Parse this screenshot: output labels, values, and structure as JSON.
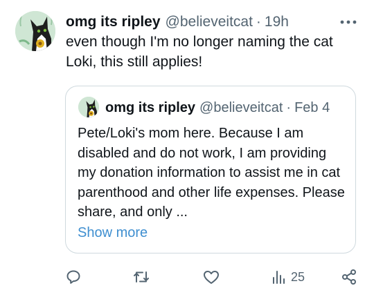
{
  "tweet": {
    "author_name": "omg its ripley",
    "author_handle": "@believeitcat",
    "separator": "·",
    "time": "19h",
    "text": "even though I'm no longer naming the cat Loki, this still applies!"
  },
  "quoted_tweet": {
    "author_name": "omg its ripley",
    "author_handle": "@believeitcat",
    "separator": "·",
    "date": "Feb 4",
    "text": "Pete/Loki's mom here. Because I am disabled and do not work, I am providing my donation information to assist me in cat parenthood and other life expenses. Please share, and only ...",
    "show_more_label": "Show more"
  },
  "actions": {
    "reply_icon": "reply-icon",
    "retweet_icon": "retweet-icon",
    "like_icon": "heart-icon",
    "views_icon": "views-chart-icon",
    "views_count": "25",
    "share_icon": "share-icon"
  },
  "colors": {
    "text_primary": "#0f1419",
    "text_secondary": "#536471",
    "link": "#3f8fd0",
    "border": "#cfd9de",
    "avatar_bg": "#cfe6d4"
  }
}
